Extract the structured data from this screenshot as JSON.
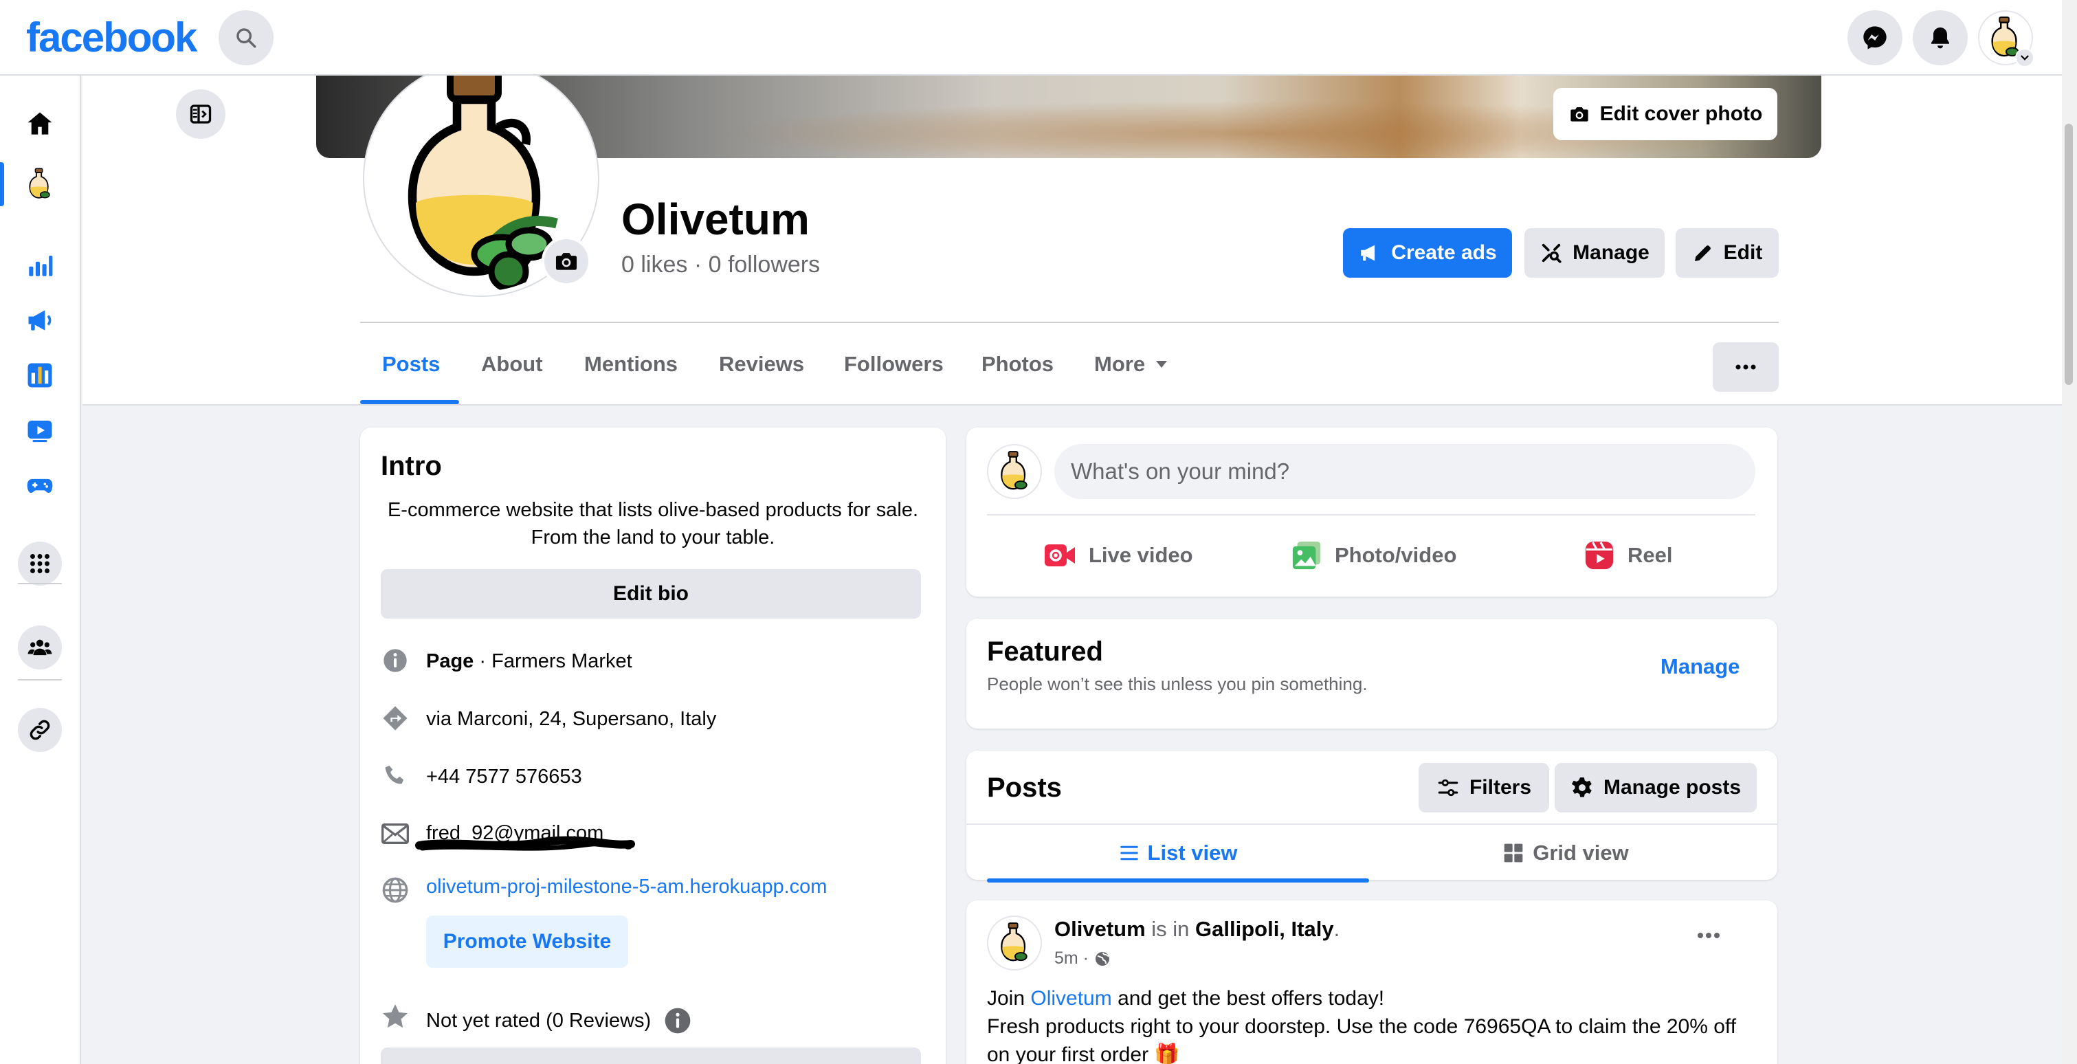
{
  "app": {
    "logo": "facebook"
  },
  "topbar": {
    "icons": [
      "search-icon",
      "messenger-icon",
      "bell-icon",
      "profile-avatar",
      "chevron-down-icon"
    ]
  },
  "leftrail": {
    "items": [
      "home-icon",
      "page-avatar",
      "insights-icon",
      "ad-center-icon",
      "meta-business-suite-icon",
      "video-icon",
      "gaming-icon",
      "apps-grid-icon",
      "groups-icon",
      "link-icon"
    ]
  },
  "cover": {
    "edit_label": "Edit cover photo"
  },
  "page": {
    "name": "Olivetum",
    "stats": "0 likes · 0 followers"
  },
  "actions": {
    "create_ads": "Create ads",
    "manage": "Manage",
    "edit": "Edit"
  },
  "tabs": [
    {
      "label": "Posts",
      "active": true
    },
    {
      "label": "About"
    },
    {
      "label": "Mentions"
    },
    {
      "label": "Reviews"
    },
    {
      "label": "Followers"
    },
    {
      "label": "Photos"
    },
    {
      "label": "More"
    }
  ],
  "intro": {
    "title": "Intro",
    "bio": "E-commerce website that lists olive-based products for sale. From the land to your table.",
    "edit_bio": "Edit bio",
    "page_type_bold": "Page",
    "page_type_rest": " · Farmers Market",
    "address": "via Marconi, 24, Supersano, Italy",
    "phone": "+44 7577 576653",
    "email": "fred_92@ymail.com",
    "website": "olivetum-proj-milestone-5-am.herokuapp.com",
    "promote": "Promote Website",
    "rating": "Not yet rated (0 Reviews)"
  },
  "composer": {
    "placeholder": "What's on your mind?",
    "live": "Live video",
    "photo": "Photo/video",
    "reel": "Reel"
  },
  "featured": {
    "title": "Featured",
    "subtitle": "People won’t see this unless you pin something.",
    "manage": "Manage"
  },
  "posts": {
    "title": "Posts",
    "filters": "Filters",
    "manage_posts": "Manage posts",
    "list_view": "List view",
    "grid_view": "Grid view"
  },
  "post": {
    "author": "Olivetum",
    "is_in": " is in ",
    "location": "Gallipoli, Italy",
    "period": ".",
    "time": "5m ·",
    "line1_pre": "Join ",
    "line1_link": "Olivetum",
    "line1_post": " and get the best offers today!",
    "line2": "Fresh products right to your doorstep. Use the code 76965QA to claim the 20% off on your first order 🎁"
  },
  "colors": {
    "brand": "#1877f2",
    "background": "#f0f2f5",
    "button_gray": "#e4e6eb",
    "secondary_text": "#65676b"
  }
}
